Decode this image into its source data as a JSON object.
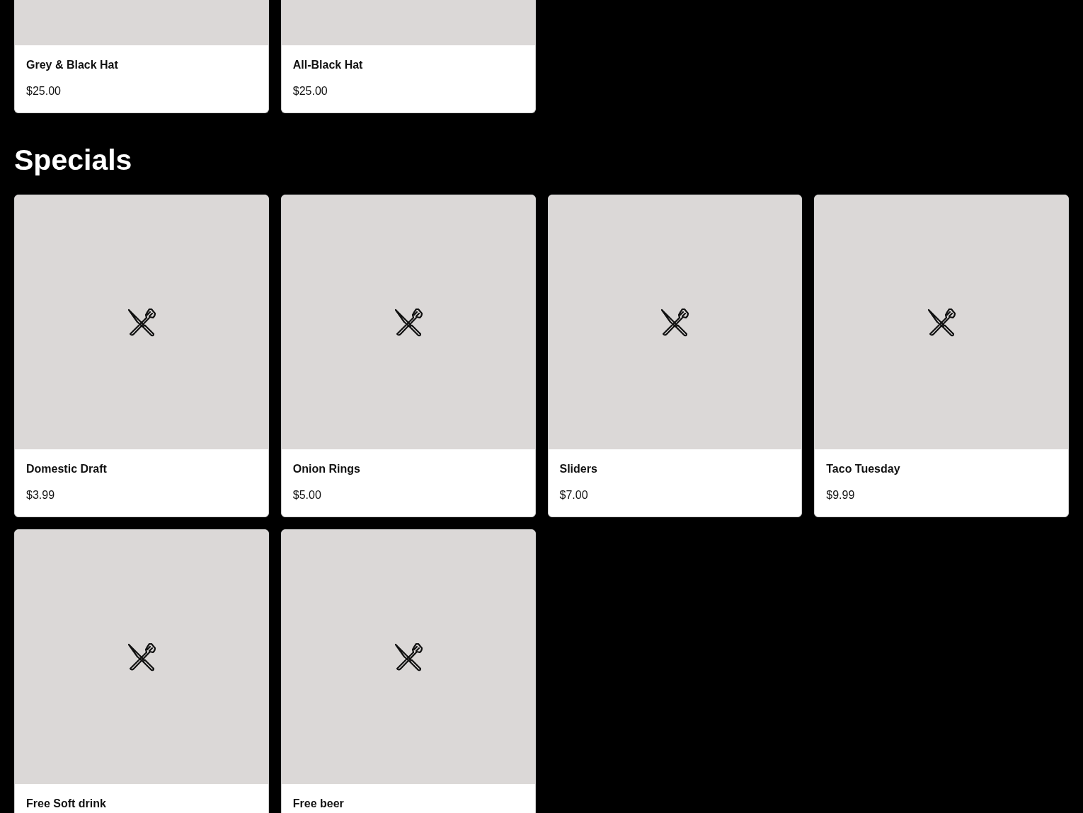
{
  "sections": [
    {
      "items": [
        {
          "name": "Grey & Black Hat",
          "price": "$25.00"
        },
        {
          "name": "All-Black Hat",
          "price": "$25.00"
        }
      ]
    },
    {
      "title": "Specials",
      "items": [
        {
          "name": "Domestic Draft",
          "price": "$3.99"
        },
        {
          "name": "Onion Rings",
          "price": "$5.00"
        },
        {
          "name": "Sliders",
          "price": "$7.00"
        },
        {
          "name": "Taco Tuesday",
          "price": "$9.99"
        },
        {
          "name": "Free Soft drink"
        },
        {
          "name": "Free beer"
        }
      ]
    }
  ]
}
